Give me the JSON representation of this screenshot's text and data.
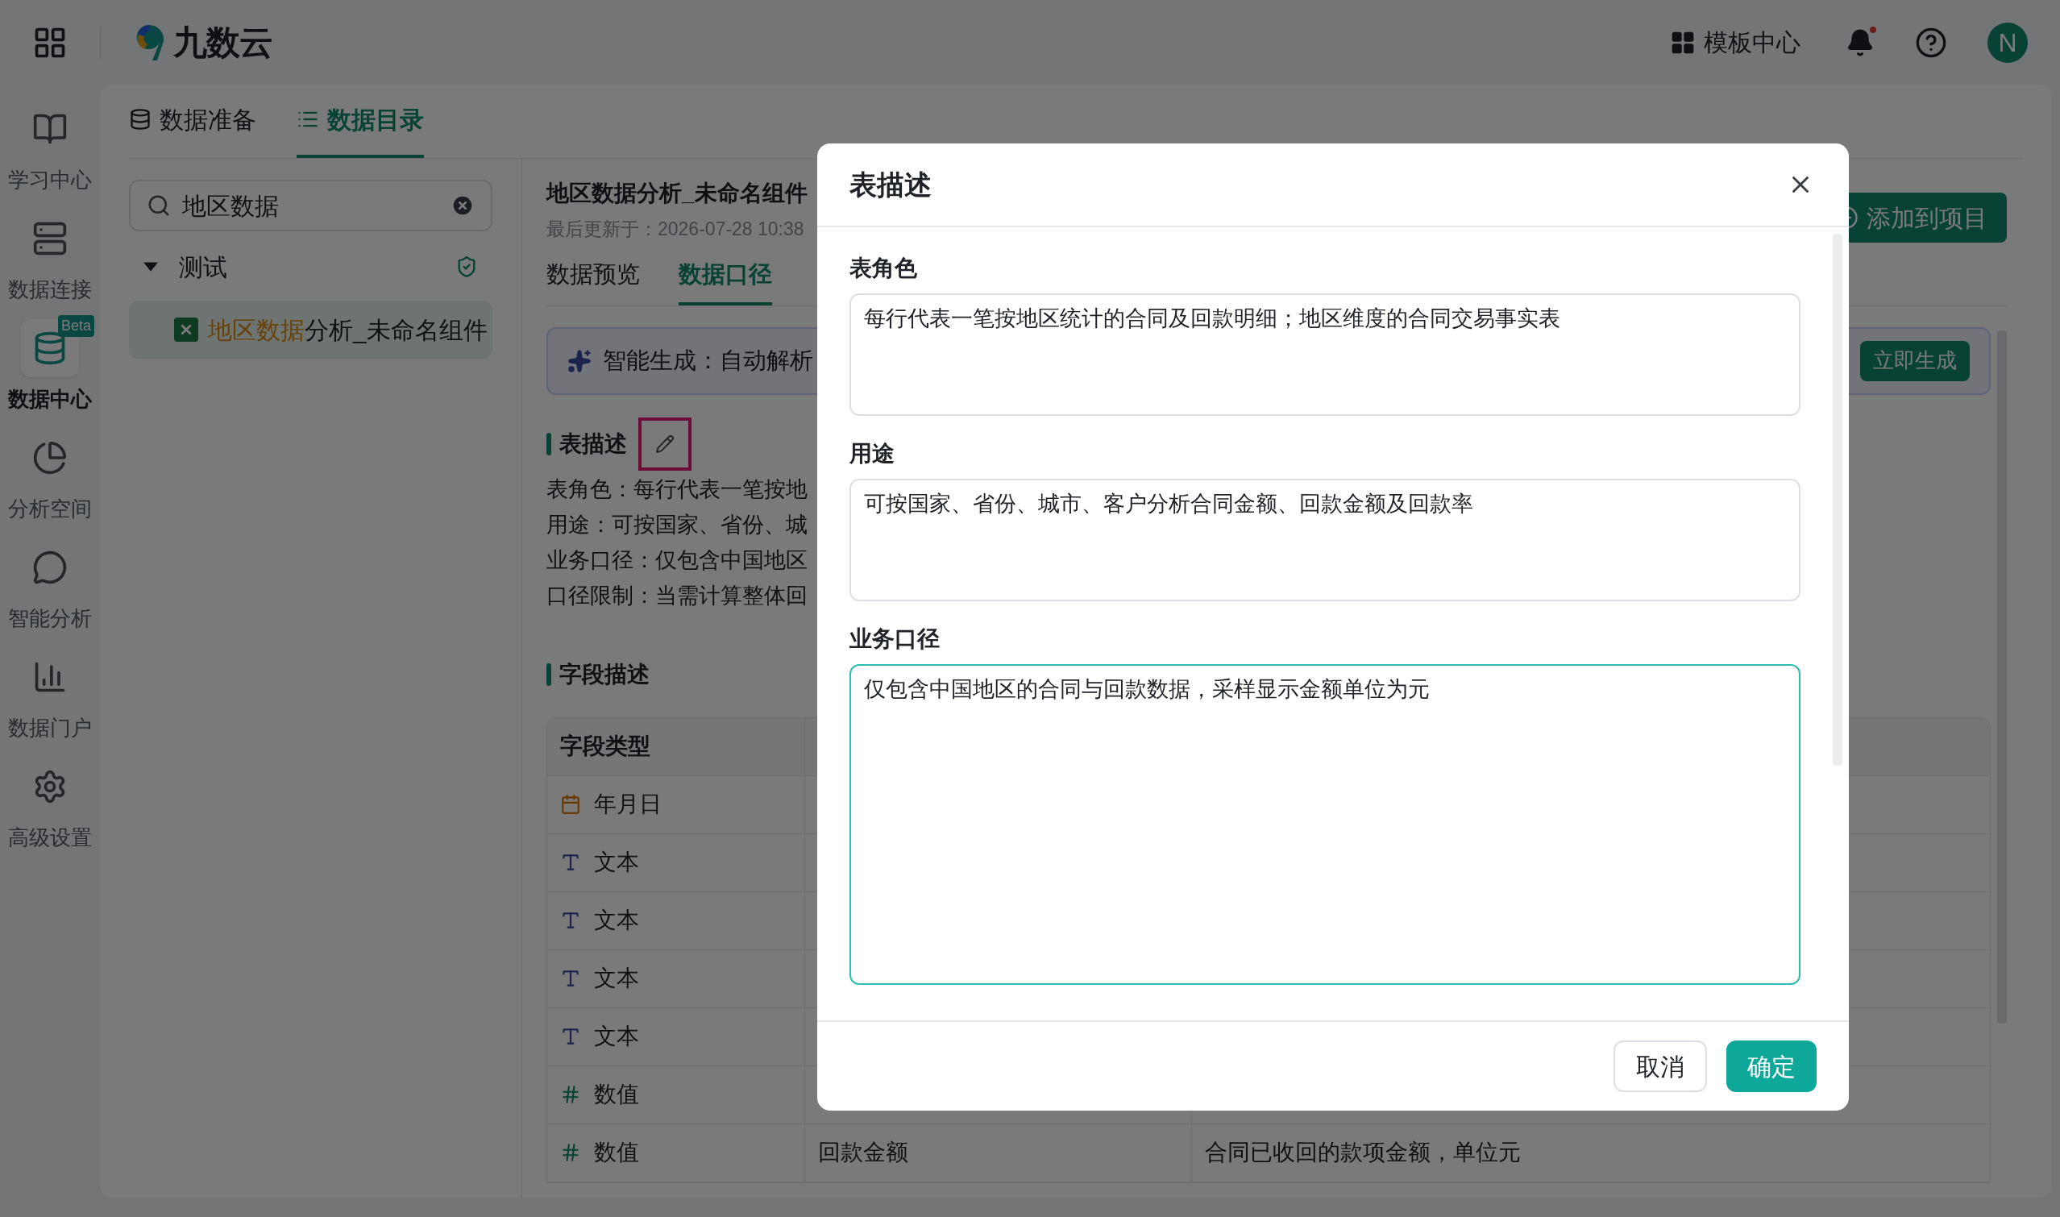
{
  "topbar": {
    "brand": "九数云",
    "template_center": "模板中心",
    "has_unread": true,
    "avatar": "N"
  },
  "nav": [
    {
      "label": "学习中心",
      "selected": false
    },
    {
      "label": "数据连接",
      "selected": false
    },
    {
      "label": "数据中心",
      "selected": true,
      "badge": "Beta"
    },
    {
      "label": "分析空间",
      "selected": false
    },
    {
      "label": "智能分析",
      "selected": false
    },
    {
      "label": "数据门户",
      "selected": false
    },
    {
      "label": "高级设置",
      "selected": false
    }
  ],
  "tabs": [
    {
      "label": "数据准备",
      "selected": false
    },
    {
      "label": "数据目录",
      "selected": true
    }
  ],
  "search": {
    "value": "地区数据"
  },
  "tree": [
    {
      "label": "测试",
      "expanded": true,
      "children": [
        {
          "match": "地区数据",
          "rest": "分析_未命名组件",
          "selected": true
        }
      ]
    }
  ],
  "detail": {
    "title": "地区数据分析_未命名组件",
    "updated": "最后更新于：2026-07-28 10:38",
    "tabs": [
      {
        "label": "数据预览",
        "selected": false
      },
      {
        "label": "数据口径",
        "selected": true
      }
    ],
    "add_button": "添加到项目",
    "ai_banner": {
      "text": "智能生成：自动解析",
      "button": "立即生成"
    },
    "description_heading": "表描述",
    "description_lines": [
      "表角色：每行代表一笔按地",
      "用途：可按国家、省份、城",
      "业务口径：仅包含中国地区",
      "口径限制：当需计算整体回"
    ],
    "fields_heading": "字段描述",
    "table": {
      "columns": [
        "字段类型"
      ],
      "rows": [
        {
          "kind": "date",
          "type": "年月日"
        },
        {
          "kind": "text",
          "type": "文本"
        },
        {
          "kind": "text",
          "type": "文本"
        },
        {
          "kind": "text",
          "type": "文本"
        },
        {
          "kind": "text",
          "type": "文本"
        },
        {
          "kind": "number",
          "type": "数值"
        },
        {
          "kind": "number",
          "type": "数值",
          "column_2": "回款金额",
          "column_3": "合同已收回的款项金额，单位元"
        }
      ]
    }
  },
  "dialog": {
    "title": "表描述",
    "fields": [
      {
        "label": "表角色",
        "value": "每行代表一笔按地区统计的合同及回款明细；地区维度的合同交易事实表",
        "focused": false
      },
      {
        "label": "用途",
        "value": "可按国家、省份、城市、客户分析合同金额、回款金额及回款率",
        "focused": false
      },
      {
        "label": "业务口径",
        "value": "仅包含中国地区的合同与回款数据，采样显示金额单位为元",
        "focused": true
      }
    ],
    "buttons": [
      {
        "label": "取消",
        "kind": "secondary"
      },
      {
        "label": "确定",
        "kind": "primary"
      }
    ]
  }
}
